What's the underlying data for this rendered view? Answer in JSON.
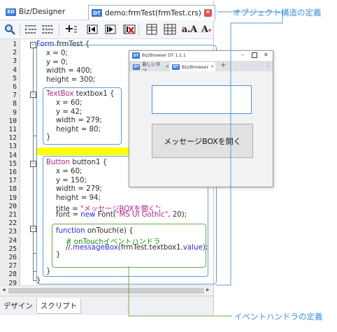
{
  "ide": {
    "tabs": [
      {
        "icon": "ED",
        "label": "Biz/Designer"
      },
      {
        "icon": "DT",
        "label": "demo:frmTest(frmTest.crs)"
      }
    ],
    "bottom_tabs": [
      "デザイン",
      "スクリプト"
    ],
    "toolbar_icons": [
      "search-icon",
      "indent-icon",
      "outdent-icon",
      "add-icon",
      "step-back-icon",
      "step-into-icon",
      "step-over-icon",
      "clear-breakpoint-icon",
      "grid-icon",
      "table-icon",
      "font-larger-icon",
      "font-smaller-icon"
    ]
  },
  "code": {
    "line_numbers": [
      "1",
      "2",
      "3",
      "4",
      "5",
      "6",
      "7",
      "8",
      "9",
      "10",
      "11",
      "12",
      "13",
      "14",
      "15",
      "16",
      "17",
      "18",
      "19",
      "20",
      "21",
      "22",
      "23",
      "24",
      "25",
      "26",
      "27",
      "28",
      "29"
    ],
    "lines": {
      "l1_kw": "Form",
      "l1_rest": " frmTest {",
      "l2": "x = 0;",
      "l3": "y = 0;",
      "l4": "width = 400;",
      "l5": "height = 300;",
      "l7_kw": "TextBox",
      "l7_rest": " textbox1 {",
      "l8": "x = 60;",
      "l9": "y = 42;",
      "l10": "width = 279;",
      "l11": "height = 80;",
      "l12": "}",
      "l15_kw": "Button",
      "l15_rest": " button1 {",
      "l16": "x = 60;",
      "l17": "y = 150;",
      "l18": "width = 279;",
      "l19": "height = 94;",
      "l20_a": "title = ",
      "l20_str": "\"メッセージBOXを開く\"",
      "l20_b": ";",
      "l21_a": "font = ",
      "l21_kw": "new",
      "l21_b": " Font(",
      "l21_str": "\"MS UI Gothic\"",
      "l21_c": ", 20);",
      "l23_kw": "function",
      "l23_rest": " onTouch(e) {",
      "l24": "# onTouchイベントハンドラ",
      "l25_a": "//.",
      "l25_b": "messageBox",
      "l25_c": "(frmTest.textbox1.",
      "l25_d": "value",
      "l25_e": ");",
      "l26": "}",
      "l28": "}",
      "l29": "}"
    }
  },
  "browser": {
    "title": "Biz/Browser DT 1.1.1",
    "tabs": [
      {
        "icon": "DT",
        "label": "新しいタブ"
      },
      {
        "icon": "DT",
        "label": "Biz/Browser"
      }
    ],
    "new_tab": "+",
    "menu": "⋮",
    "button_label": "メッセージBOXを開く"
  },
  "annotations": {
    "object_definition": "オブジェクト構造の定義",
    "event_handler_definition": "イベントハンドラの定義"
  },
  "colors": {
    "annotation": "#3a8fd9",
    "highlight": "#ffff00",
    "keyword": "#2b2bd6",
    "class": "#b0258b",
    "comment": "#1a8f1a"
  }
}
